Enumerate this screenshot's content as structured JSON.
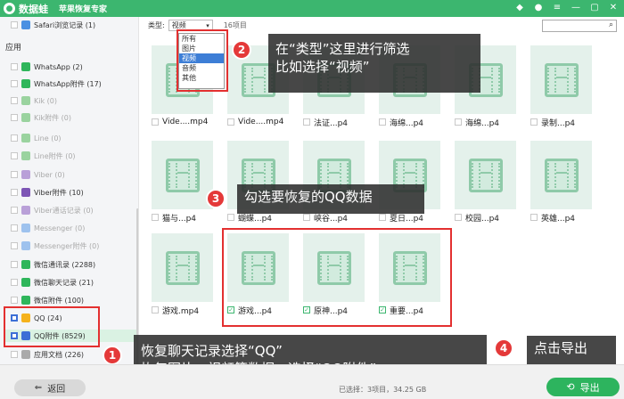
{
  "app": {
    "name": "数据蛙",
    "subtitle": "苹果恢复专家"
  },
  "titlebar_icons": [
    "diamond-icon",
    "user-icon",
    "menu-icon",
    "minimize-icon",
    "maximize-icon",
    "close-icon"
  ],
  "sidebar": {
    "section_label": "应用",
    "items": [
      {
        "label": "Safari浏览记录 (1)",
        "icon": "safari-icon",
        "color": "#4a90e2",
        "dim": false,
        "checked": false
      },
      {
        "label": "WhatsApp (2)",
        "icon": "whatsapp-icon",
        "color": "#2fb65b",
        "dim": false,
        "checked": false
      },
      {
        "label": "WhatsApp附件 (17)",
        "icon": "whatsapp-attachment-icon",
        "color": "#2fb65b",
        "dim": false,
        "checked": false
      },
      {
        "label": "Kik (0)",
        "icon": "kik-icon",
        "color": "#9ad39f",
        "dim": true,
        "checked": false
      },
      {
        "label": "Kik附件 (0)",
        "icon": "kik-attachment-icon",
        "color": "#9ad39f",
        "dim": true,
        "checked": false
      },
      {
        "label": "Line (0)",
        "icon": "line-icon",
        "color": "#9ad39f",
        "dim": true,
        "checked": false
      },
      {
        "label": "Line附件 (0)",
        "icon": "line-attachment-icon",
        "color": "#9ad39f",
        "dim": true,
        "checked": false
      },
      {
        "label": "Viber (0)",
        "icon": "viber-icon",
        "color": "#b9a0d8",
        "dim": true,
        "checked": false
      },
      {
        "label": "Viber附件 (10)",
        "icon": "viber-attachment-icon",
        "color": "#7d55b5",
        "dim": false,
        "checked": false
      },
      {
        "label": "Viber通话记录 (0)",
        "icon": "viber-call-icon",
        "color": "#b9a0d8",
        "dim": true,
        "checked": false
      },
      {
        "label": "Messenger (0)",
        "icon": "messenger-icon",
        "color": "#9ec2ee",
        "dim": true,
        "checked": false
      },
      {
        "label": "Messenger附件 (0)",
        "icon": "messenger-attachment-icon",
        "color": "#9ec2ee",
        "dim": true,
        "checked": false
      },
      {
        "label": "微信通讯录 (2288)",
        "icon": "wechat-contacts-icon",
        "color": "#2fb65b",
        "dim": false,
        "checked": false
      },
      {
        "label": "微信聊天记录 (21)",
        "icon": "wechat-chat-icon",
        "color": "#2fb65b",
        "dim": false,
        "checked": false
      },
      {
        "label": "微信附件 (100)",
        "icon": "wechat-attachment-icon",
        "color": "#2fb65b",
        "dim": false,
        "checked": false
      },
      {
        "label": "QQ (24)",
        "icon": "qq-icon",
        "color": "#f5b21c",
        "dim": false,
        "checked": true
      },
      {
        "label": "QQ附件 (8529)",
        "icon": "qq-attachment-icon",
        "color": "#3d6fd6",
        "dim": false,
        "checked": true
      },
      {
        "label": "应用文档 (226)",
        "icon": "app-docs-icon",
        "color": "#aaaaaa",
        "dim": false,
        "checked": false
      }
    ]
  },
  "toolbar": {
    "type_label": "类型:",
    "type_value": "视频",
    "count_label": "16项目"
  },
  "dropdown_options": [
    "所有",
    "图片",
    "视频",
    "音频",
    "其他"
  ],
  "dropdown_active": "视频",
  "files": [
    {
      "name": "Vide....mp4",
      "checked": false
    },
    {
      "name": "Vide....mp4",
      "checked": false
    },
    {
      "name": "法证...p4",
      "checked": false
    },
    {
      "name": "海绵...p4",
      "checked": false
    },
    {
      "name": "海绵...p4",
      "checked": false
    },
    {
      "name": "录制...p4",
      "checked": false
    },
    {
      "name": "猫与...p4",
      "checked": false
    },
    {
      "name": "蝴蝶...p4",
      "checked": false
    },
    {
      "name": "峡谷...p4",
      "checked": false
    },
    {
      "name": "夏日...p4",
      "checked": false
    },
    {
      "name": "校园...p4",
      "checked": false
    },
    {
      "name": "英雄...p4",
      "checked": false
    },
    {
      "name": "游戏.mp4",
      "checked": false
    },
    {
      "name": "游戏...p4",
      "checked": true
    },
    {
      "name": "原神...p4",
      "checked": true
    },
    {
      "name": "重要...p4",
      "checked": true
    }
  ],
  "callouts": {
    "c1_num": "1",
    "c1_line1": "恢复聊天记录选择“QQ”",
    "c1_line2": "恢复图片、视频等数据，选择“QQ附件”",
    "c2_num": "2",
    "c2_line1": "在“类型”这里进行筛选",
    "c2_line2": "比如选择“视频”",
    "c3_num": "3",
    "c3_text": "勾选要恢复的QQ数据",
    "c4_num": "4",
    "c4_text": "点击导出"
  },
  "bottom": {
    "back_label": "返回",
    "export_label": "导出",
    "status": "已选择：3项目，34.25 GB"
  },
  "colors": {
    "brand_green": "#3cb66f",
    "export_green": "#2db45e",
    "annotation_red": "#e33030",
    "selection_blue": "#3d6fd6"
  }
}
